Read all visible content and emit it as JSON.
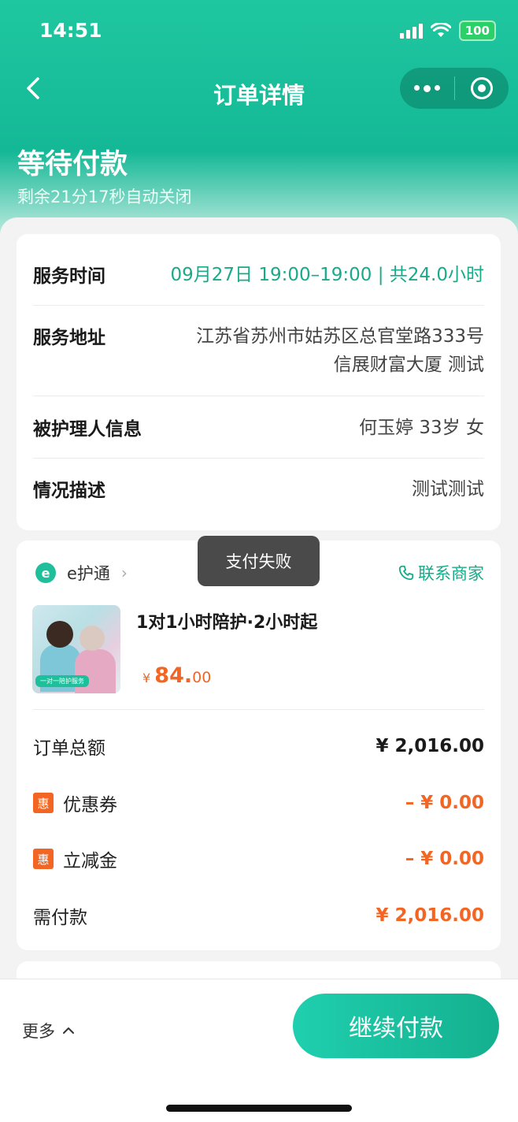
{
  "status_bar": {
    "time": "14:51",
    "battery": "100"
  },
  "nav": {
    "title": "订单详情"
  },
  "order_status": {
    "title": "等待付款",
    "countdown": "剩余21分17秒自动关闭"
  },
  "info": {
    "service_time_label": "服务时间",
    "service_time_value": "09月27日 19:00–19:00 | 共24.0小时",
    "address_label": "服务地址",
    "address_line1": "江苏省苏州市姑苏区总官堂路333号",
    "address_line2": "信展财富大厦 测试",
    "patient_label": "被护理人信息",
    "patient_value": "何玉婷 33岁 女",
    "desc_label": "情况描述",
    "desc_value": "测试测试"
  },
  "merchant": {
    "logo_text": "e",
    "name": "e护通",
    "contact": "联系商家"
  },
  "product": {
    "name": "1对1小时陪护·2小时起",
    "image_tag": "一对一陪护服务",
    "price_currency": "¥",
    "price_int": "84.",
    "price_dec": "00"
  },
  "fees": {
    "total_label": "订单总额",
    "total_value": "¥ 2,016.00",
    "coupon_badge": "惠",
    "coupon_label": "优惠券",
    "coupon_value": "– ¥ 0.00",
    "discount_badge": "惠",
    "discount_label": "立减金",
    "discount_value": "– ¥ 0.00",
    "due_label": "需付款",
    "due_value": "¥ 2,016.00"
  },
  "toast": {
    "text": "支付失败"
  },
  "bottom": {
    "more_label": "更多",
    "pay_label": "继续付款"
  },
  "colors": {
    "brand": "#1fc7a0",
    "accent_green": "#1aaa8a",
    "price_orange": "#f26522"
  }
}
